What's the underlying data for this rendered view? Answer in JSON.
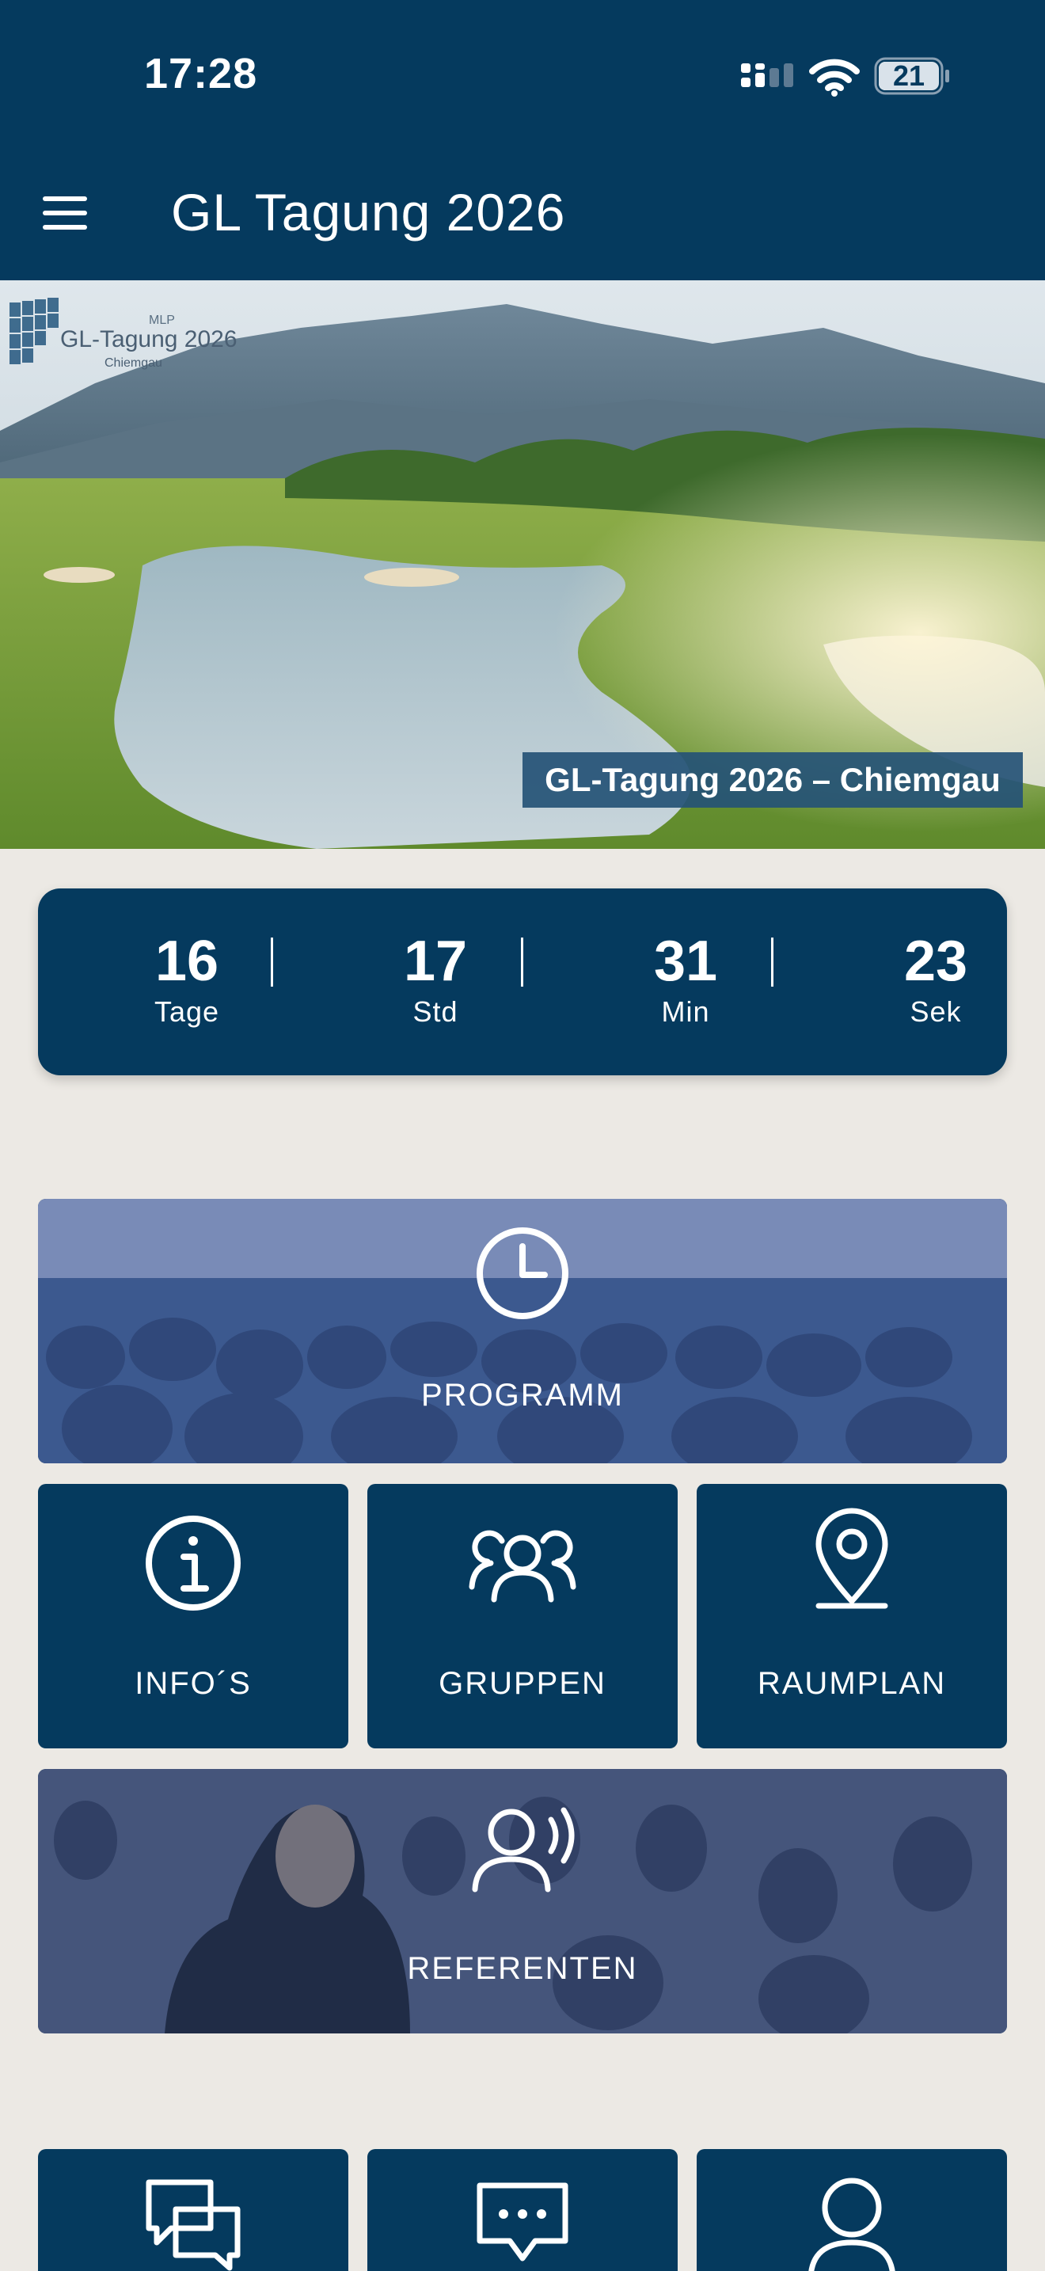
{
  "status_bar": {
    "time": "17:28",
    "battery": "21"
  },
  "header": {
    "title": "GL Tagung 2026"
  },
  "hero": {
    "logo_brand": "MLP",
    "logo_title": "GL-Tagung 2026",
    "logo_subtitle": "Chiemgau",
    "caption": "GL-Tagung 2026 – Chiemgau"
  },
  "countdown": [
    {
      "value": "16",
      "unit": "Tage"
    },
    {
      "value": "17",
      "unit": "Std"
    },
    {
      "value": "31",
      "unit": "Min"
    },
    {
      "value": "23",
      "unit": "Sek"
    }
  ],
  "tiles": {
    "programm": "PROGRAMM",
    "infos": "INFO´S",
    "gruppen": "GRUPPEN",
    "raumplan": "RAUMPLAN",
    "referenten": "REFERENTEN"
  },
  "icons": {
    "menu": "menu-icon",
    "programm": "clock-icon",
    "infos": "info-icon",
    "gruppen": "group-icon",
    "raumplan": "location-pin-icon",
    "referenten": "speaker-icon",
    "chat": "chat-bubbles-icon",
    "message": "message-dots-icon",
    "profile": "person-icon"
  },
  "colors": {
    "primary": "#053A5E",
    "background": "#ECE9E4",
    "text": "#FFFFFF"
  }
}
